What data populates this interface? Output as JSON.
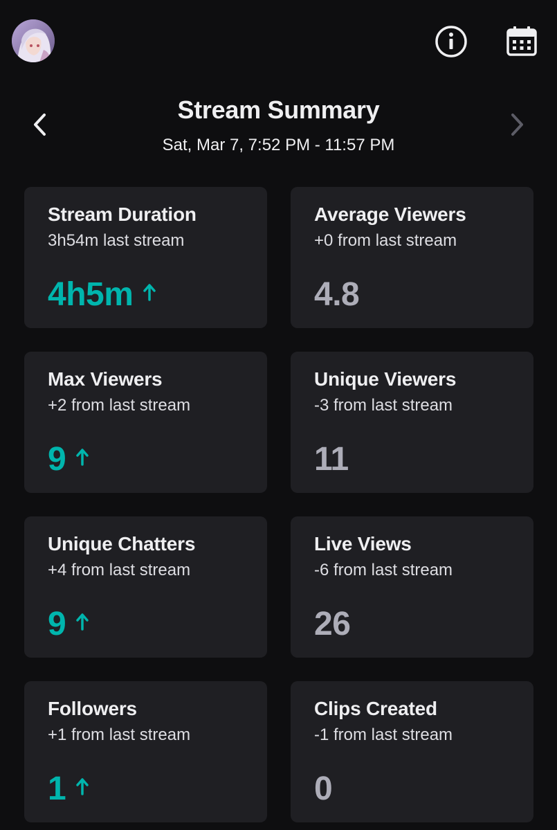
{
  "header": {
    "title": "Stream Summary",
    "date_range": "Sat, Mar 7, 7:52 PM - 11:57 PM"
  },
  "icons": {
    "info": "info-icon",
    "calendar": "calendar-icon",
    "prev": "chevron-left-icon",
    "next": "chevron-right-icon",
    "up": "arrow-up-icon"
  },
  "colors": {
    "background": "#0e0e10",
    "card": "#1f1f23",
    "accent_up": "#00b5ad",
    "neutral_value": "#adadb8"
  },
  "stats": [
    {
      "title": "Stream Duration",
      "comparison": "3h54m last stream",
      "value": "4h5m",
      "trend": "up"
    },
    {
      "title": "Average Viewers",
      "comparison": "+0 from last stream",
      "value": "4.8",
      "trend": "neutral"
    },
    {
      "title": "Max Viewers",
      "comparison": "+2 from last stream",
      "value": "9",
      "trend": "up"
    },
    {
      "title": "Unique Viewers",
      "comparison": "-3 from last stream",
      "value": "11",
      "trend": "neutral"
    },
    {
      "title": "Unique Chatters",
      "comparison": "+4 from last stream",
      "value": "9",
      "trend": "up"
    },
    {
      "title": "Live Views",
      "comparison": "-6 from last stream",
      "value": "26",
      "trend": "neutral"
    },
    {
      "title": "Followers",
      "comparison": "+1 from last stream",
      "value": "1",
      "trend": "up"
    },
    {
      "title": "Clips Created",
      "comparison": "-1 from last stream",
      "value": "0",
      "trend": "neutral"
    }
  ]
}
